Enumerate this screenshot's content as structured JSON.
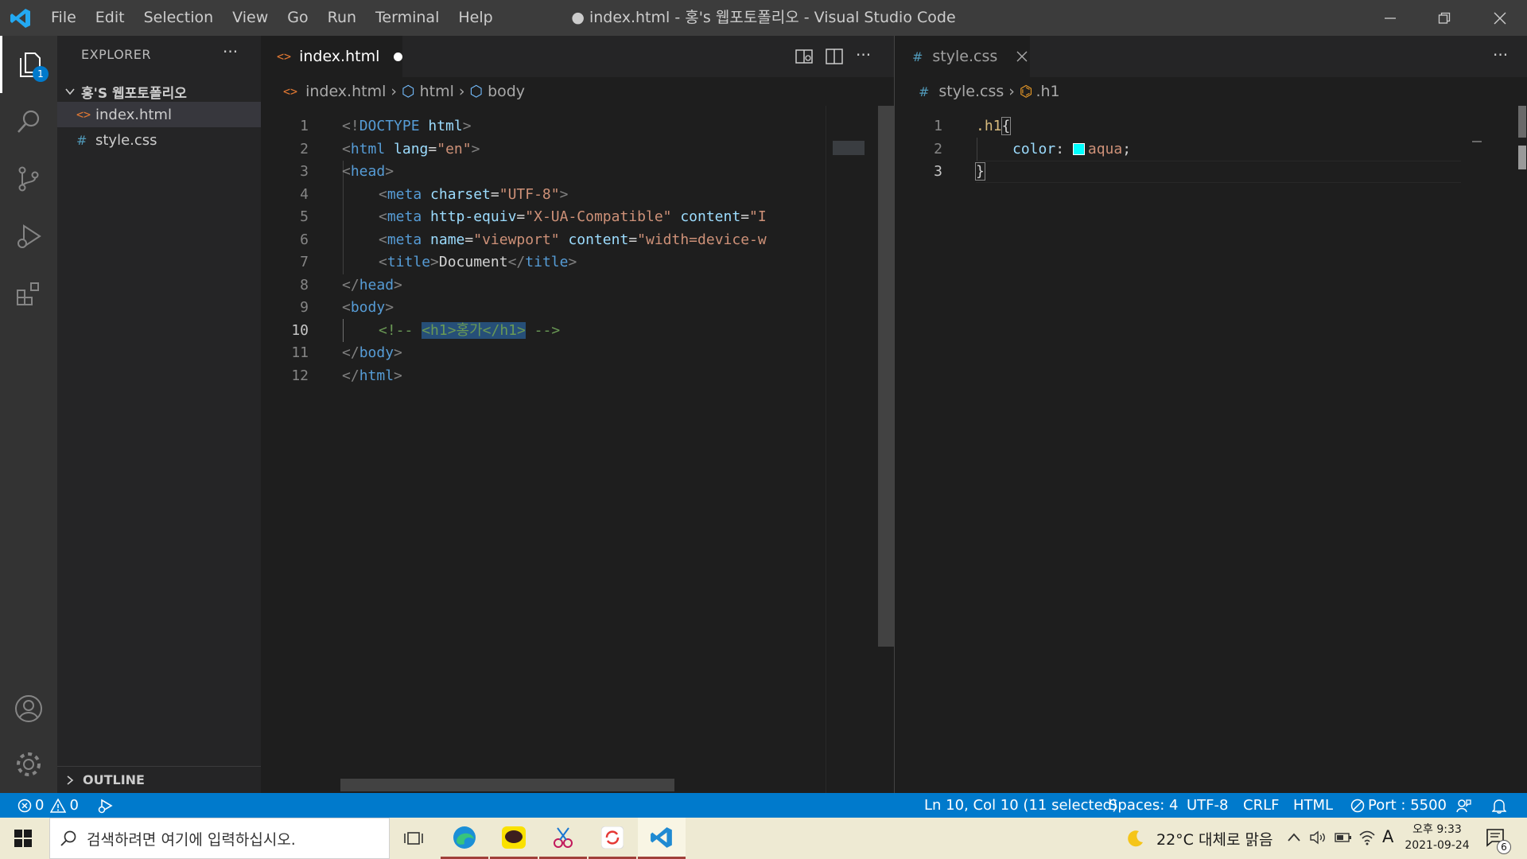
{
  "titlebar": {
    "menu": [
      "File",
      "Edit",
      "Selection",
      "View",
      "Go",
      "Run",
      "Terminal",
      "Help"
    ],
    "title": "● index.html - 홍's 웹포토폴리오 - Visual Studio Code"
  },
  "activity": {
    "explorer_badge": "1",
    "icons": [
      "explorer-icon",
      "search-icon",
      "source-control-icon",
      "run-debug-icon",
      "extensions-icon",
      "account-icon",
      "settings-gear-icon"
    ]
  },
  "sidebar": {
    "title": "EXPLORER",
    "more": "···",
    "folder": "홍'S 웹포토폴리오",
    "files": [
      {
        "name": "index.html",
        "icon": "<>"
      },
      {
        "name": "style.css",
        "icon": "#"
      }
    ],
    "outline": "OUTLINE"
  },
  "editor_left": {
    "tab_label": "index.html",
    "breadcrumb": [
      "index.html",
      "html",
      "body"
    ],
    "line_numbers": [
      "1",
      "2",
      "3",
      "4",
      "5",
      "6",
      "7",
      "8",
      "9",
      "10",
      "11",
      "12"
    ],
    "code": {
      "l1": {
        "a": "<!",
        "b": "DOCTYPE",
        "c": " html",
        "d": ">"
      },
      "l2": {
        "a": "<",
        "b": "html",
        "c": " lang",
        "d": "=",
        "e": "\"en\"",
        "f": ">"
      },
      "l3": {
        "a": "<",
        "b": "head",
        "c": ">"
      },
      "l4": {
        "a": "<",
        "b": "meta",
        "c": " charset",
        "d": "=",
        "e": "\"UTF-8\"",
        "f": ">"
      },
      "l5": {
        "a": "<",
        "b": "meta",
        "c": " http-equiv",
        "d": "=",
        "e": "\"X-UA-Compatible\"",
        "f": " content",
        "g": "=",
        "h": "\"IE=ed"
      },
      "l6": {
        "a": "<",
        "b": "meta",
        "c": " name",
        "d": "=",
        "e": "\"viewport\"",
        "f": " content",
        "g": "=",
        "h": "\"width=device-width"
      },
      "l7": {
        "a": "<",
        "b": "title",
        "c": ">",
        "d": "Document",
        "e": "</",
        "f": "title",
        "g": ">"
      },
      "l8": {
        "a": "</",
        "b": "head",
        "c": ">"
      },
      "l9": {
        "a": "<",
        "b": "body",
        "c": ">"
      },
      "l10": {
        "a": "<!-- ",
        "b": "<h1>홍가</h1>",
        "c": " -->"
      },
      "l11": {
        "a": "</",
        "b": "body",
        "c": ">"
      },
      "l12": {
        "a": "</",
        "b": "html",
        "c": ">"
      }
    }
  },
  "editor_right": {
    "tab_label": "style.css",
    "breadcrumb": [
      "style.css",
      ".h1"
    ],
    "line_numbers": [
      "1",
      "2",
      "3"
    ],
    "code": {
      "l1": {
        "a": ".h1",
        "b": "{"
      },
      "l2": {
        "a": "color",
        "b": ": ",
        "c": "aqua",
        "d": ";"
      },
      "l3": {
        "a": "}"
      }
    },
    "swatch_color": "#00ffff"
  },
  "statusbar": {
    "errors": "0",
    "warnings": "0",
    "position": "Ln 10, Col 10 (11 selected)",
    "spaces": "Spaces: 4",
    "encoding": "UTF-8",
    "eol": "CRLF",
    "language": "HTML",
    "port": "Port : 5500"
  },
  "taskbar": {
    "search_placeholder": "검색하려면 여기에 입력하십시오.",
    "weather": "22°C  대체로 맑음",
    "time": "오후 9:33",
    "date": "2021-09-24",
    "ime": "A",
    "notif_count": "6"
  },
  "colors": {
    "accent": "#007acc",
    "titlebar": "#3c3c3c",
    "activitybar": "#333333",
    "sidebar": "#252526",
    "editor": "#1e1e1e"
  }
}
